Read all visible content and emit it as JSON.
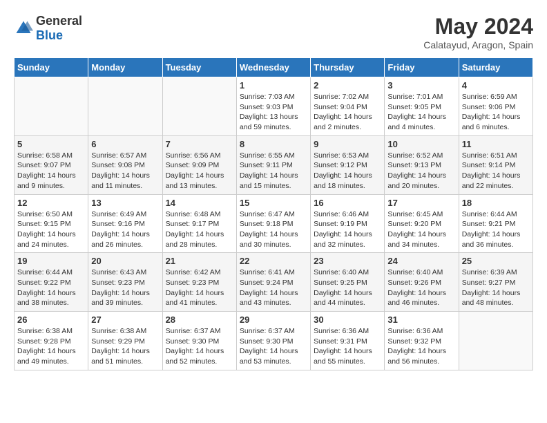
{
  "header": {
    "logo_general": "General",
    "logo_blue": "Blue",
    "month_year": "May 2024",
    "location": "Calatayud, Aragon, Spain"
  },
  "weekdays": [
    "Sunday",
    "Monday",
    "Tuesday",
    "Wednesday",
    "Thursday",
    "Friday",
    "Saturday"
  ],
  "weeks": [
    [
      {
        "day": "",
        "sunrise": "",
        "sunset": "",
        "daylight": ""
      },
      {
        "day": "",
        "sunrise": "",
        "sunset": "",
        "daylight": ""
      },
      {
        "day": "",
        "sunrise": "",
        "sunset": "",
        "daylight": ""
      },
      {
        "day": "1",
        "sunrise": "Sunrise: 7:03 AM",
        "sunset": "Sunset: 9:03 PM",
        "daylight": "Daylight: 13 hours and 59 minutes."
      },
      {
        "day": "2",
        "sunrise": "Sunrise: 7:02 AM",
        "sunset": "Sunset: 9:04 PM",
        "daylight": "Daylight: 14 hours and 2 minutes."
      },
      {
        "day": "3",
        "sunrise": "Sunrise: 7:01 AM",
        "sunset": "Sunset: 9:05 PM",
        "daylight": "Daylight: 14 hours and 4 minutes."
      },
      {
        "day": "4",
        "sunrise": "Sunrise: 6:59 AM",
        "sunset": "Sunset: 9:06 PM",
        "daylight": "Daylight: 14 hours and 6 minutes."
      }
    ],
    [
      {
        "day": "5",
        "sunrise": "Sunrise: 6:58 AM",
        "sunset": "Sunset: 9:07 PM",
        "daylight": "Daylight: 14 hours and 9 minutes."
      },
      {
        "day": "6",
        "sunrise": "Sunrise: 6:57 AM",
        "sunset": "Sunset: 9:08 PM",
        "daylight": "Daylight: 14 hours and 11 minutes."
      },
      {
        "day": "7",
        "sunrise": "Sunrise: 6:56 AM",
        "sunset": "Sunset: 9:09 PM",
        "daylight": "Daylight: 14 hours and 13 minutes."
      },
      {
        "day": "8",
        "sunrise": "Sunrise: 6:55 AM",
        "sunset": "Sunset: 9:11 PM",
        "daylight": "Daylight: 14 hours and 15 minutes."
      },
      {
        "day": "9",
        "sunrise": "Sunrise: 6:53 AM",
        "sunset": "Sunset: 9:12 PM",
        "daylight": "Daylight: 14 hours and 18 minutes."
      },
      {
        "day": "10",
        "sunrise": "Sunrise: 6:52 AM",
        "sunset": "Sunset: 9:13 PM",
        "daylight": "Daylight: 14 hours and 20 minutes."
      },
      {
        "day": "11",
        "sunrise": "Sunrise: 6:51 AM",
        "sunset": "Sunset: 9:14 PM",
        "daylight": "Daylight: 14 hours and 22 minutes."
      }
    ],
    [
      {
        "day": "12",
        "sunrise": "Sunrise: 6:50 AM",
        "sunset": "Sunset: 9:15 PM",
        "daylight": "Daylight: 14 hours and 24 minutes."
      },
      {
        "day": "13",
        "sunrise": "Sunrise: 6:49 AM",
        "sunset": "Sunset: 9:16 PM",
        "daylight": "Daylight: 14 hours and 26 minutes."
      },
      {
        "day": "14",
        "sunrise": "Sunrise: 6:48 AM",
        "sunset": "Sunset: 9:17 PM",
        "daylight": "Daylight: 14 hours and 28 minutes."
      },
      {
        "day": "15",
        "sunrise": "Sunrise: 6:47 AM",
        "sunset": "Sunset: 9:18 PM",
        "daylight": "Daylight: 14 hours and 30 minutes."
      },
      {
        "day": "16",
        "sunrise": "Sunrise: 6:46 AM",
        "sunset": "Sunset: 9:19 PM",
        "daylight": "Daylight: 14 hours and 32 minutes."
      },
      {
        "day": "17",
        "sunrise": "Sunrise: 6:45 AM",
        "sunset": "Sunset: 9:20 PM",
        "daylight": "Daylight: 14 hours and 34 minutes."
      },
      {
        "day": "18",
        "sunrise": "Sunrise: 6:44 AM",
        "sunset": "Sunset: 9:21 PM",
        "daylight": "Daylight: 14 hours and 36 minutes."
      }
    ],
    [
      {
        "day": "19",
        "sunrise": "Sunrise: 6:44 AM",
        "sunset": "Sunset: 9:22 PM",
        "daylight": "Daylight: 14 hours and 38 minutes."
      },
      {
        "day": "20",
        "sunrise": "Sunrise: 6:43 AM",
        "sunset": "Sunset: 9:23 PM",
        "daylight": "Daylight: 14 hours and 39 minutes."
      },
      {
        "day": "21",
        "sunrise": "Sunrise: 6:42 AM",
        "sunset": "Sunset: 9:23 PM",
        "daylight": "Daylight: 14 hours and 41 minutes."
      },
      {
        "day": "22",
        "sunrise": "Sunrise: 6:41 AM",
        "sunset": "Sunset: 9:24 PM",
        "daylight": "Daylight: 14 hours and 43 minutes."
      },
      {
        "day": "23",
        "sunrise": "Sunrise: 6:40 AM",
        "sunset": "Sunset: 9:25 PM",
        "daylight": "Daylight: 14 hours and 44 minutes."
      },
      {
        "day": "24",
        "sunrise": "Sunrise: 6:40 AM",
        "sunset": "Sunset: 9:26 PM",
        "daylight": "Daylight: 14 hours and 46 minutes."
      },
      {
        "day": "25",
        "sunrise": "Sunrise: 6:39 AM",
        "sunset": "Sunset: 9:27 PM",
        "daylight": "Daylight: 14 hours and 48 minutes."
      }
    ],
    [
      {
        "day": "26",
        "sunrise": "Sunrise: 6:38 AM",
        "sunset": "Sunset: 9:28 PM",
        "daylight": "Daylight: 14 hours and 49 minutes."
      },
      {
        "day": "27",
        "sunrise": "Sunrise: 6:38 AM",
        "sunset": "Sunset: 9:29 PM",
        "daylight": "Daylight: 14 hours and 51 minutes."
      },
      {
        "day": "28",
        "sunrise": "Sunrise: 6:37 AM",
        "sunset": "Sunset: 9:30 PM",
        "daylight": "Daylight: 14 hours and 52 minutes."
      },
      {
        "day": "29",
        "sunrise": "Sunrise: 6:37 AM",
        "sunset": "Sunset: 9:30 PM",
        "daylight": "Daylight: 14 hours and 53 minutes."
      },
      {
        "day": "30",
        "sunrise": "Sunrise: 6:36 AM",
        "sunset": "Sunset: 9:31 PM",
        "daylight": "Daylight: 14 hours and 55 minutes."
      },
      {
        "day": "31",
        "sunrise": "Sunrise: 6:36 AM",
        "sunset": "Sunset: 9:32 PM",
        "daylight": "Daylight: 14 hours and 56 minutes."
      },
      {
        "day": "",
        "sunrise": "",
        "sunset": "",
        "daylight": ""
      }
    ]
  ]
}
